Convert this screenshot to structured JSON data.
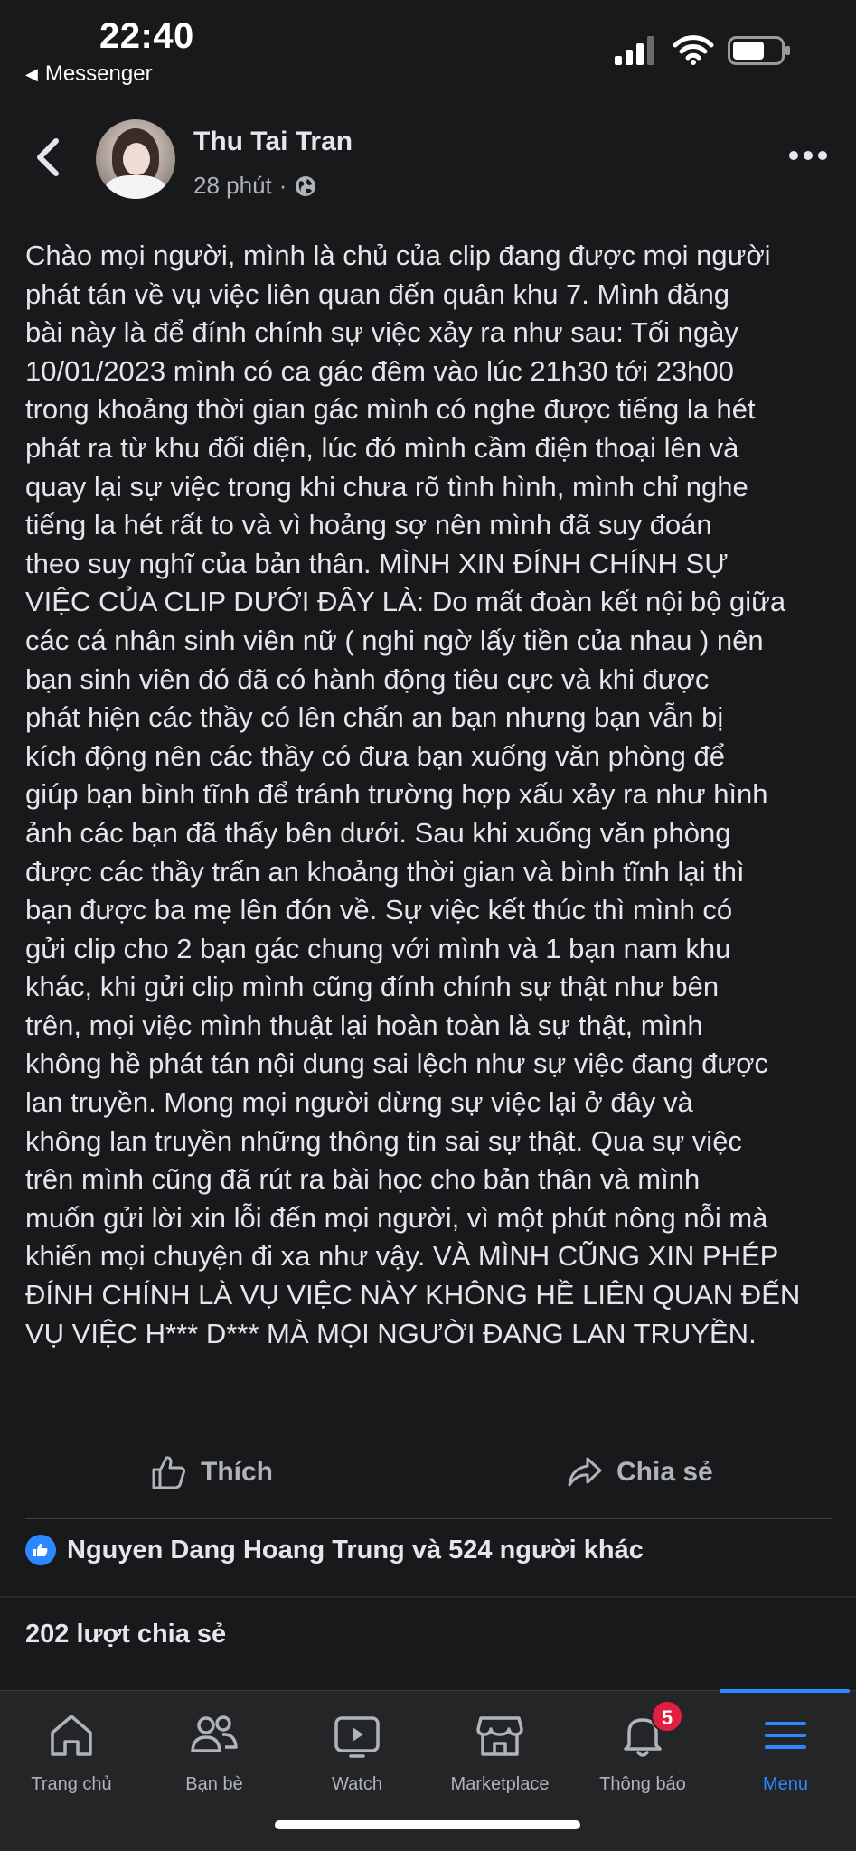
{
  "status_bar": {
    "time": "22:40",
    "back_app_label": "Messenger",
    "icons": [
      "cellular-signal-icon",
      "wifi-icon",
      "battery-icon"
    ]
  },
  "post": {
    "author": "Thu Tai Tran",
    "time_ago": "28 phút",
    "separator": "·",
    "privacy_icon": "globe-icon",
    "body_lines": [
      "Chào mọi người, mình là chủ của clip đang được mọi người",
      "phát tán về vụ việc liên quan đến quân khu 7. Mình đăng",
      "bài này là để đính chính sự việc xảy ra như sau: Tối ngày",
      "10/01/2023 mình có ca gác đêm vào lúc 21h30 tới 23h00",
      "trong khoảng thời gian gác mình có nghe được tiếng la hét",
      "phát ra từ khu đối diện, lúc đó mình cầm điện thoại lên và",
      "quay lại sự việc trong khi chưa rõ tình hình, mình chỉ nghe",
      "tiếng la hét rất to và vì hoảng sợ nên mình đã suy đoán",
      "theo suy nghĩ của bản thân. MÌNH XIN ĐÍNH CHÍNH SỰ",
      "VIỆC CỦA CLIP DƯỚI ĐÂY LÀ: Do mất đoàn kết nội bộ giữa",
      "các cá nhân sinh viên nữ ( nghi ngờ lấy tiền của nhau ) nên",
      "bạn sinh viên đó đã có hành động tiêu cực và khi được",
      "phát hiện các thầy có lên chấn an bạn nhưng bạn vẫn bị",
      "kích động nên các thầy có đưa bạn xuống văn phòng để",
      "giúp bạn bình tĩnh để tránh trường hợp xấu xảy ra như hình",
      "ảnh các bạn đã thấy bên dưới. Sau khi xuống văn phòng",
      "được các thầy trấn an khoảng thời gian và bình tĩnh lại thì",
      "bạn được ba mẹ lên đón về. Sự việc kết thúc thì mình có",
      "gửi clip cho 2 bạn gác chung với mình và 1 bạn nam khu",
      "khác, khi gửi clip mình cũng đính chính sự thật như bên",
      "trên, mọi việc mình thuật lại hoàn toàn là sự thật, mình",
      "không hề phát tán nội dung sai lệch như sự việc đang được",
      "lan truyền. Mong mọi người dừng sự việc lại ở đây và",
      "không lan truyền những thông tin sai sự thật. Qua sự việc",
      "trên mình cũng đã rút ra bài học cho bản thân và mình",
      "muốn gửi lời xin lỗi đến mọi người, vì một phút nông nỗi mà",
      "khiến mọi chuyện đi xa như vậy. VÀ MÌNH CŨNG XIN PHÉP",
      "ĐÍNH CHÍNH LÀ VỤ VIỆC NÀY KHÔNG HỀ LIÊN QUAN ĐẾN",
      "VỤ VIỆC H*** D*** MÀ MỌI NGƯỜI ĐANG LAN TRUYỀN."
    ],
    "actions": {
      "like": "Thích",
      "share": "Chia sẻ"
    },
    "reactions_text": "Nguyen Dang Hoang Trung và 524 người khác",
    "shares_text": "202 lượt chia sẻ"
  },
  "tabbar": {
    "tabs": [
      {
        "label": "Trang chủ",
        "icon": "home-icon"
      },
      {
        "label": "Bạn bè",
        "icon": "friends-icon"
      },
      {
        "label": "Watch",
        "icon": "watch-icon"
      },
      {
        "label": "Marketplace",
        "icon": "marketplace-icon"
      },
      {
        "label": "Thông báo",
        "icon": "bell-icon",
        "badge": "5"
      },
      {
        "label": "Menu",
        "icon": "menu-icon",
        "active": true
      }
    ]
  },
  "colors": {
    "background": "#18191a",
    "text": "#e4e6eb",
    "secondary_text": "#b0b3b8",
    "accent": "#2d88ff",
    "badge": "#e41e3f"
  }
}
